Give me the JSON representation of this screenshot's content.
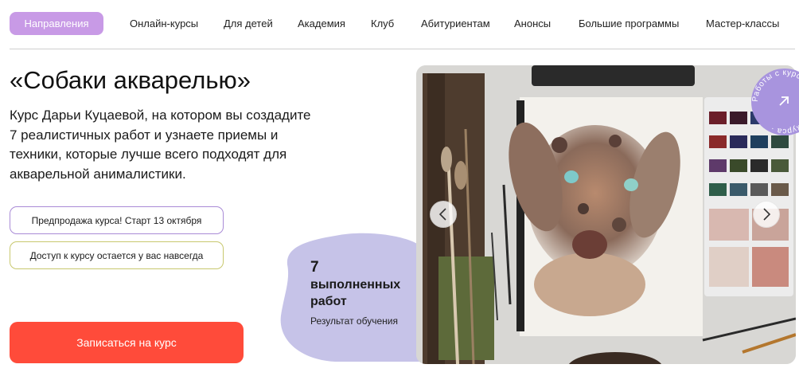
{
  "nav": {
    "active": "Направления",
    "items": [
      "Онлайн-курсы",
      "Для детей",
      "Академия",
      "Клуб",
      "Абитуриентам",
      "Анонсы",
      "Большие программы",
      "Мастер-классы"
    ]
  },
  "hero": {
    "title": "«Собаки акварелью»",
    "description": "Курс Дарьи Куцаевой, на котором вы создадите 7 реалистичных работ и узнаете приемы и техники, которые лучше всего подходят для акварельной анималистики.",
    "tags": [
      "Предпродажа курса! Старт 13 октября",
      "Доступ к курсу остается у вас навсегда"
    ],
    "cta": "Записаться на курс"
  },
  "stat": {
    "number": "7",
    "line1": "выполненных",
    "line2": "работ",
    "caption": "Результат обучения"
  },
  "badge": {
    "text": "Работы с курса · Работы с курса ·"
  },
  "colors": {
    "accent_purple": "#c89ae6",
    "cta_red": "#ff4b3a",
    "blob_lavender": "#c6c3e8",
    "badge_purple": "#a894de"
  }
}
